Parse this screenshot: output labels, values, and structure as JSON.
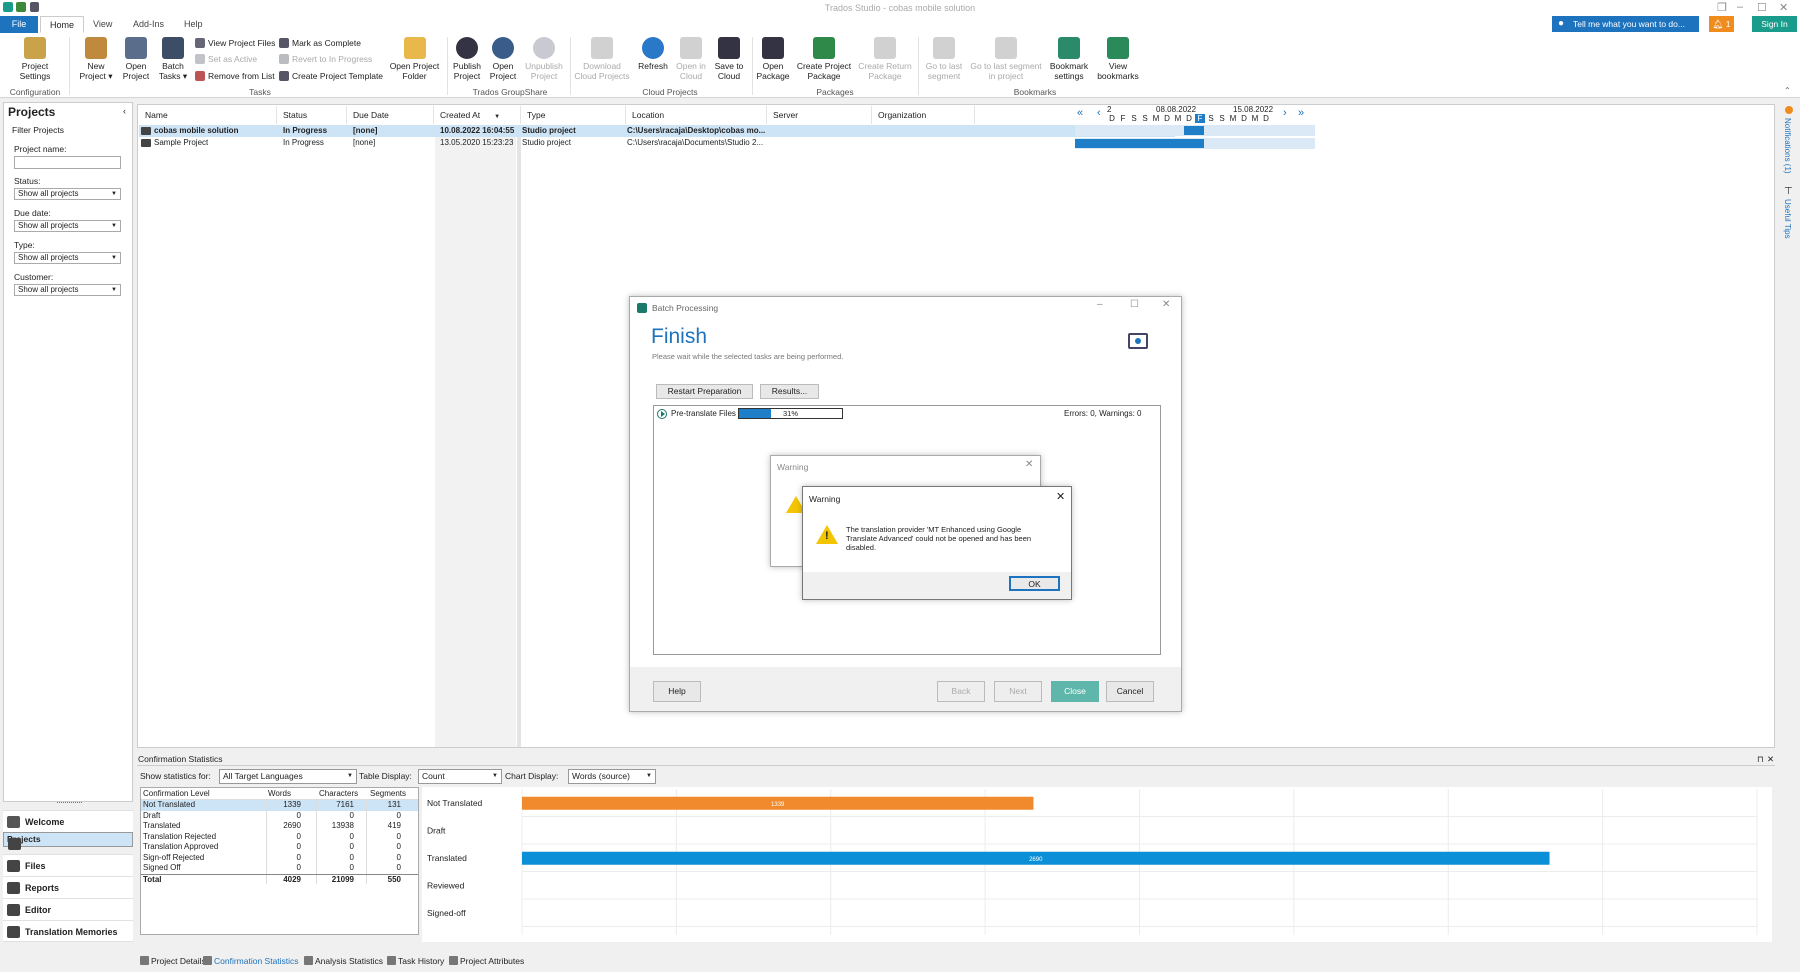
{
  "app": {
    "title": "Trados Studio - cobas mobile solution"
  },
  "menu": {
    "tabs": [
      "File",
      "Home",
      "View",
      "Add-Ins",
      "Help"
    ],
    "tell_me": "Tell me what you want to do...",
    "alerts_count": "1",
    "sign_in": "Sign In"
  },
  "ribbon": {
    "project_settings": [
      "Project",
      "Settings"
    ],
    "new_project": [
      "New",
      "Project ▾"
    ],
    "open_project": [
      "Open",
      "Project"
    ],
    "batch_tasks": [
      "Batch",
      "Tasks ▾"
    ],
    "view_project_files": "View Project Files",
    "set_as_active": "Set as Active",
    "remove_from_list": "Remove from List",
    "mark_as_complete": "Mark as Complete",
    "revert_to_in_progress": "Revert to In Progress",
    "create_project_template": "Create Project Template",
    "open_project_folder": [
      "Open Project",
      "Folder"
    ],
    "publish_project": [
      "Publish",
      "Project"
    ],
    "open_project_gs": [
      "Open",
      "Project"
    ],
    "unpublish_project": [
      "Unpublish",
      "Project"
    ],
    "download_cloud_projects": [
      "Download",
      "Cloud Projects"
    ],
    "refresh": [
      "Refresh",
      ""
    ],
    "open_in_cloud": [
      "Open in",
      "Cloud"
    ],
    "save_to_cloud": [
      "Save to",
      "Cloud"
    ],
    "open_package": [
      "Open",
      "Package"
    ],
    "create_project_package": [
      "Create Project",
      "Package"
    ],
    "create_return_package": [
      "Create Return",
      "Package"
    ],
    "go_to_last_segment": [
      "Go to last",
      "segment"
    ],
    "go_to_last_segment_in_project": [
      "Go to last segment",
      "in project"
    ],
    "bookmark_settings": [
      "Bookmark",
      "settings"
    ],
    "view_bookmarks": [
      "View",
      "bookmarks"
    ],
    "groups": [
      "Configuration",
      "Tasks",
      "Trados GroupShare",
      "Cloud Projects",
      "Packages",
      "Bookmarks"
    ]
  },
  "projects_panel": {
    "title": "Projects",
    "filter_title": "Filter Projects",
    "project_name_label": "Project name:",
    "status_label": "Status:",
    "status_value": "Show all projects",
    "due_date_label": "Due date:",
    "due_date_value": "Show all projects",
    "type_label": "Type:",
    "type_value": "Show all projects",
    "customer_label": "Customer:",
    "customer_value": "Show all projects"
  },
  "nav": [
    "Welcome",
    "Projects",
    "Files",
    "Reports",
    "Editor",
    "Translation Memories"
  ],
  "grid": {
    "headers": [
      "Name",
      "Status",
      "Due Date",
      "Created At",
      "Type",
      "Location",
      "Server",
      "Organization"
    ],
    "rows": [
      {
        "name": "cobas mobile solution",
        "status": "In Progress",
        "due": "[none]",
        "created": "10.08.2022 16:04:55",
        "type": "Studio project",
        "location": "C:\\Users\\racaja\\Desktop\\cobas mo..."
      },
      {
        "name": "Sample Project",
        "status": "In Progress",
        "due": "[none]",
        "created": "13.05.2020 15:23:23",
        "type": "Studio project",
        "location": "C:\\Users\\racaja\\Documents\\Studio 2..."
      }
    ],
    "gantt": {
      "week_num": "2",
      "date1": "08.08.2022",
      "date2": "15.08.2022",
      "days": [
        "D",
        "F",
        "S",
        "S",
        "M",
        "D",
        "M",
        "D",
        "F",
        "S",
        "S",
        "M",
        "D",
        "M",
        "D"
      ]
    }
  },
  "side": {
    "notifications": "Notifications (1)",
    "useful_tips": "Useful Tips"
  },
  "stats": {
    "title": "Confirmation Statistics",
    "show_for_label": "Show statistics for:",
    "show_for_value": "All Target Languages",
    "table_display_label": "Table Display:",
    "table_display_value": "Count",
    "chart_display_label": "Chart Display:",
    "chart_display_value": "Words (source)",
    "table_headers": [
      "Confirmation Level",
      "Words",
      "Characters",
      "Segments"
    ],
    "rows": [
      [
        "Not Translated",
        "1339",
        "7161",
        "131"
      ],
      [
        "Draft",
        "0",
        "0",
        "0"
      ],
      [
        "Translated",
        "2690",
        "13938",
        "419"
      ],
      [
        "Translation Rejected",
        "0",
        "0",
        "0"
      ],
      [
        "Translation Approved",
        "0",
        "0",
        "0"
      ],
      [
        "Sign-off Rejected",
        "0",
        "0",
        "0"
      ],
      [
        "Signed Off",
        "0",
        "0",
        "0"
      ],
      [
        "Total",
        "4029",
        "21099",
        "550"
      ]
    ]
  },
  "chart_data": {
    "type": "bar",
    "categories": [
      "Not Translated",
      "Draft",
      "Translated",
      "Reviewed",
      "Signed-off"
    ],
    "values": [
      1339,
      0,
      2690,
      0,
      0
    ],
    "colors": [
      "#f08a2c",
      "#1e73be",
      "#0b8fd6",
      "#888888",
      "#888888"
    ],
    "xlim": [
      0,
      2690
    ]
  },
  "bottom_tabs": [
    "Project Details",
    "Confirmation Statistics",
    "Analysis Statistics",
    "Task History",
    "Project Attributes"
  ],
  "batch": {
    "window_title": "Batch Processing",
    "heading": "Finish",
    "subtitle": "Please wait while the selected tasks are being performed.",
    "restart": "Restart Preparation",
    "results": "Results...",
    "task_name": "Pre-translate Files",
    "progress_text": "31%",
    "progress": 0.31,
    "errors": "Errors: 0, Warnings: 0",
    "help": "Help",
    "back": "Back",
    "next": "Next",
    "close": "Close",
    "cancel": "Cancel"
  },
  "warning_back": {
    "title": "Warning"
  },
  "warning": {
    "title": "Warning",
    "message": "The translation provider 'MT Enhanced using Google Translate Advanced' could not be opened and has been disabled.",
    "ok": "OK"
  }
}
